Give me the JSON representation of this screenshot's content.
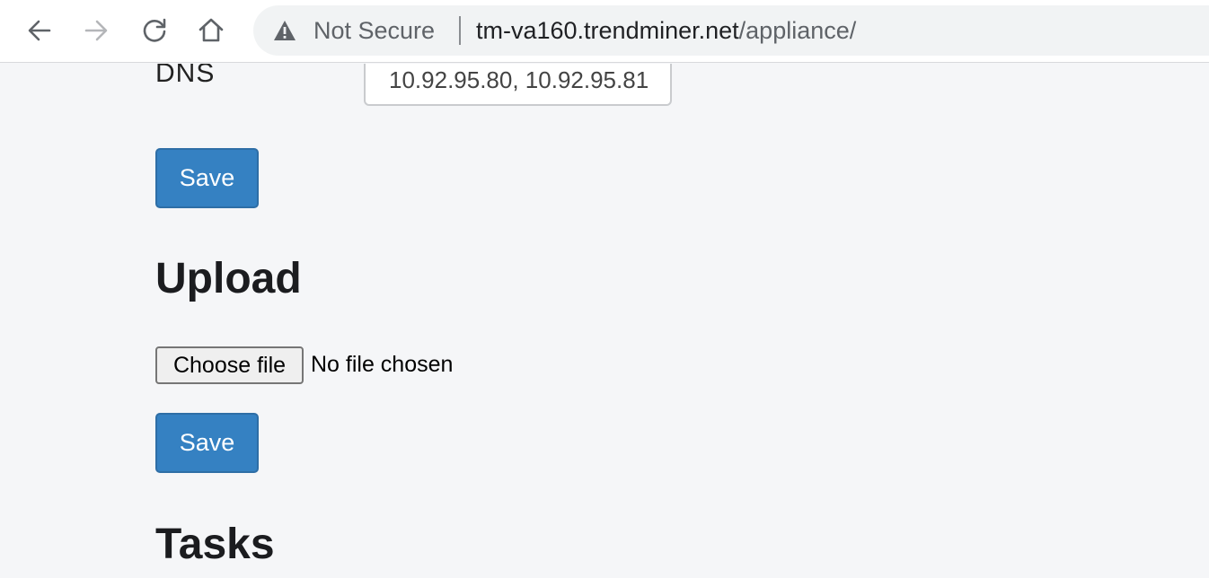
{
  "browser": {
    "security_label": "Not Secure",
    "url_host": "tm-va160.trendminer.net",
    "url_path": "/appliance/",
    "icons": [
      "back-arrow-icon",
      "forward-arrow-icon",
      "reload-icon",
      "home-icon",
      "warning-icon"
    ]
  },
  "network": {
    "dns_label": "DNS",
    "dns_value": "10.92.95.80, 10.92.95.81",
    "save_label": "Save"
  },
  "upload": {
    "heading": "Upload",
    "choose_file_label": "Choose file",
    "no_file_text": "No file chosen",
    "save_label": "Save"
  },
  "tasks": {
    "heading": "Tasks"
  },
  "colors": {
    "page_background": "#f5f6f8",
    "primary_button": "#3581c2",
    "omnibox_background": "#f1f3f4"
  }
}
